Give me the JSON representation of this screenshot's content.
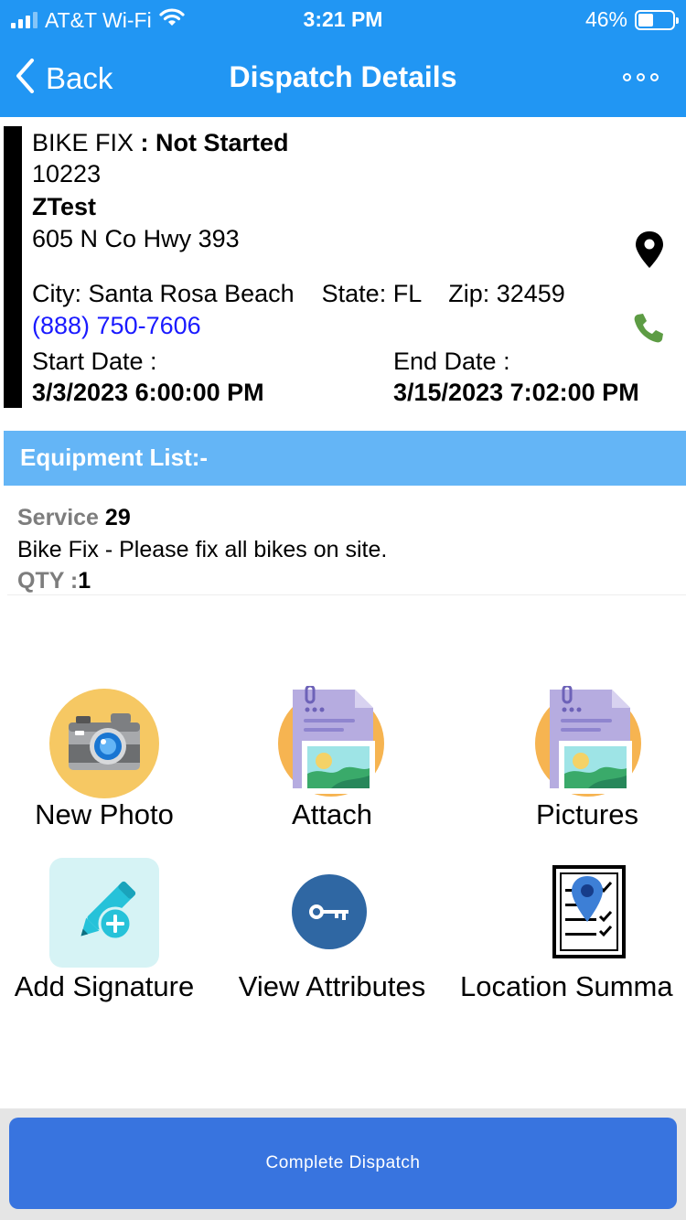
{
  "status_bar": {
    "carrier": "AT&T Wi-Fi",
    "time": "3:21 PM",
    "battery": "46%",
    "battery_level": 0.46
  },
  "nav": {
    "back_label": "Back",
    "title": "Dispatch Details"
  },
  "dispatch": {
    "job_type": "BIKE FIX",
    "status_separator": " : ",
    "status": "Not Started",
    "job_number": "10223",
    "customer": "ZTest",
    "address": "605 N Co Hwy 393",
    "city_state_zip": "City: Santa Rosa Beach    State: FL    Zip: 32459",
    "phone": "(888) 750-7606",
    "start_label": "Start Date :",
    "start_value": "3/3/2023 6:00:00 PM",
    "end_label": "End Date :",
    "end_value": "3/15/2023 7:02:00 PM"
  },
  "equipment": {
    "header": "Equipment List:-",
    "items": [
      {
        "service_label": "Service",
        "service_value": "29",
        "description": "Bike Fix - Please fix all bikes on site.",
        "qty_label": "QTY :",
        "qty_value": "1"
      }
    ]
  },
  "actions": [
    {
      "label": "New Photo",
      "icon": "camera-icon"
    },
    {
      "label": "Attach",
      "icon": "attach-document-icon"
    },
    {
      "label": "Pictures",
      "icon": "pictures-document-icon"
    },
    {
      "label": "Add Signature",
      "icon": "pen-add-icon"
    },
    {
      "label": "View Attributes",
      "icon": "key-icon"
    },
    {
      "label": "Location Summa",
      "icon": "location-summary-icon"
    }
  ],
  "footer": {
    "complete_label": "Complete Dispatch"
  },
  "colors": {
    "header_blue": "#2196f3",
    "equipment_header": "#64b5f6",
    "complete_button": "#3874df",
    "phone_link": "#1a1aff"
  }
}
